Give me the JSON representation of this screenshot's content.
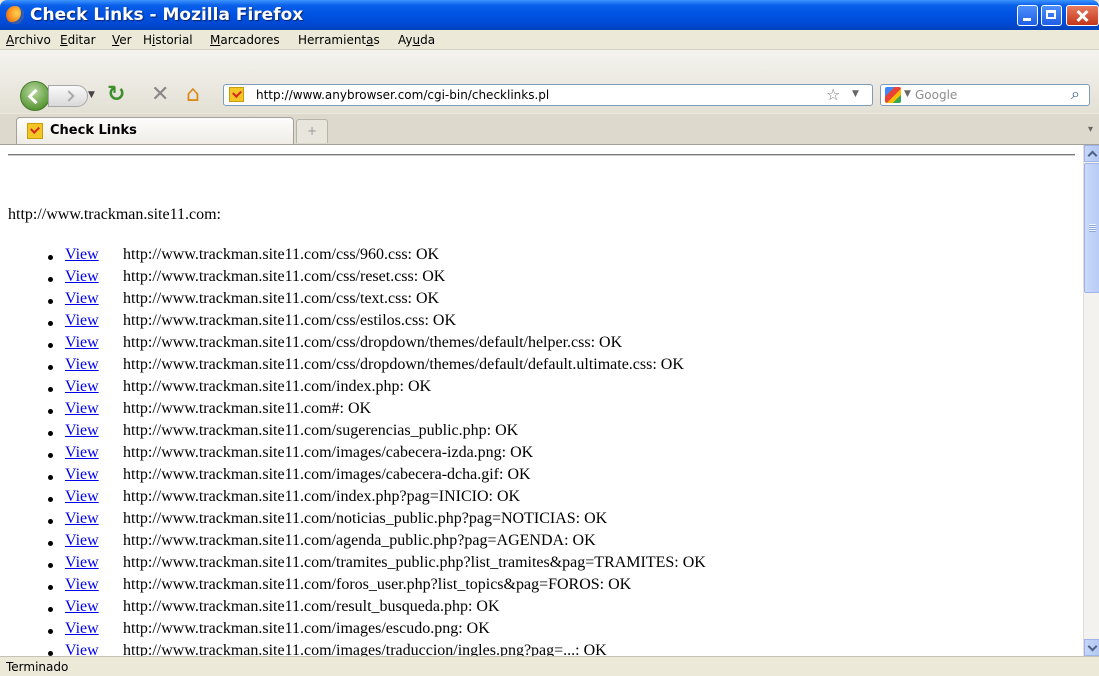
{
  "window": {
    "title": "Check Links - Mozilla Firefox"
  },
  "menu": [
    {
      "label": "Archivo"
    },
    {
      "label": "Editar"
    },
    {
      "label": "Ver"
    },
    {
      "label": "Historial"
    },
    {
      "label": "Marcadores"
    },
    {
      "label": "Herramientas"
    },
    {
      "label": "Ayuda"
    }
  ],
  "navbar": {
    "url": "http://www.anybrowser.com/cgi-bin/checklinks.pl",
    "search_placeholder": "Google"
  },
  "tabs": [
    {
      "label": "Check Links",
      "active": true
    }
  ],
  "page": {
    "host": "http://www.trackman.site11.com:",
    "links": [
      {
        "view": "View",
        "text": "http://www.trackman.site11.com/css/960.css: OK"
      },
      {
        "view": "View",
        "text": "http://www.trackman.site11.com/css/reset.css: OK"
      },
      {
        "view": "View",
        "text": "http://www.trackman.site11.com/css/text.css: OK"
      },
      {
        "view": "View",
        "text": "http://www.trackman.site11.com/css/estilos.css: OK"
      },
      {
        "view": "View",
        "text": "http://www.trackman.site11.com/css/dropdown/themes/default/helper.css: OK"
      },
      {
        "view": "View",
        "text": "http://www.trackman.site11.com/css/dropdown/themes/default/default.ultimate.css: OK"
      },
      {
        "view": "View",
        "text": "http://www.trackman.site11.com/index.php: OK"
      },
      {
        "view": "View",
        "text": "http://www.trackman.site11.com#: OK"
      },
      {
        "view": "View",
        "text": "http://www.trackman.site11.com/sugerencias_public.php: OK"
      },
      {
        "view": "View",
        "text": "http://www.trackman.site11.com/images/cabecera-izda.png: OK"
      },
      {
        "view": "View",
        "text": "http://www.trackman.site11.com/images/cabecera-dcha.gif: OK"
      },
      {
        "view": "View",
        "text": "http://www.trackman.site11.com/index.php?pag=INICIO: OK"
      },
      {
        "view": "View",
        "text": "http://www.trackman.site11.com/noticias_public.php?pag=NOTICIAS: OK"
      },
      {
        "view": "View",
        "text": "http://www.trackman.site11.com/agenda_public.php?pag=AGENDA: OK"
      },
      {
        "view": "View",
        "text": "http://www.trackman.site11.com/tramites_public.php?list_tramites&pag=TRAMITES: OK"
      },
      {
        "view": "View",
        "text": "http://www.trackman.site11.com/foros_user.php?list_topics&pag=FOROS: OK"
      },
      {
        "view": "View",
        "text": "http://www.trackman.site11.com/result_busqueda.php: OK"
      },
      {
        "view": "View",
        "text": "http://www.trackman.site11.com/images/escudo.png: OK"
      },
      {
        "view": "View",
        "text": "http://www.trackman.site11.com/images/traduccion/ingles.png?pag=...: OK"
      }
    ]
  },
  "status": {
    "text": "Terminado"
  },
  "colors": {
    "titlebar": "#0054e3",
    "link": "#0000ee",
    "chrome": "#ece9d8"
  },
  "icons": [
    "firefox-logo-icon",
    "back-icon",
    "forward-icon",
    "reload-icon",
    "stop-icon",
    "home-icon",
    "bookmark-star-icon",
    "google-icon",
    "search-icon",
    "new-tab-icon"
  ]
}
